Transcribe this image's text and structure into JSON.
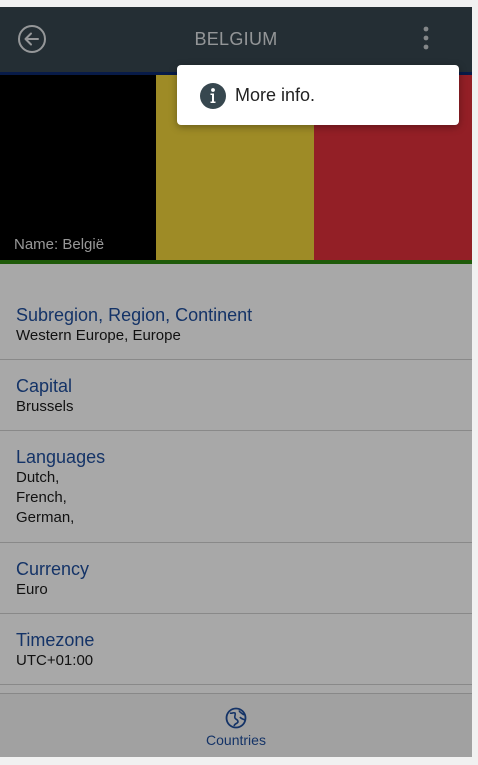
{
  "header": {
    "title": "BELGIUM",
    "back_icon": "arrow-left-circle-icon",
    "menu_icon": "more-vertical-icon",
    "bg_color": "#37474f"
  },
  "flag": {
    "name_label": "Name: België",
    "colors": [
      "#000000",
      "#b5a233",
      "#b21f2c"
    ]
  },
  "sections": [
    {
      "label": "Subregion, Region, Continent",
      "values": [
        "Western Europe, Europe"
      ]
    },
    {
      "label": "Capital",
      "values": [
        "Brussels"
      ]
    },
    {
      "label": "Languages",
      "values": [
        "Dutch,",
        "French,",
        "German,"
      ]
    },
    {
      "label": "Currency",
      "values": [
        "Euro"
      ]
    },
    {
      "label": "Timezone",
      "values": [
        "UTC+01:00"
      ]
    }
  ],
  "bottom_nav": {
    "label": "Countries",
    "icon": "globe-icon"
  },
  "popup_menu": {
    "item_label": "More info.",
    "item_icon": "info-icon"
  },
  "colors": {
    "accent_blue": "#1f4e9d",
    "green_bar": "#2f8a10"
  }
}
